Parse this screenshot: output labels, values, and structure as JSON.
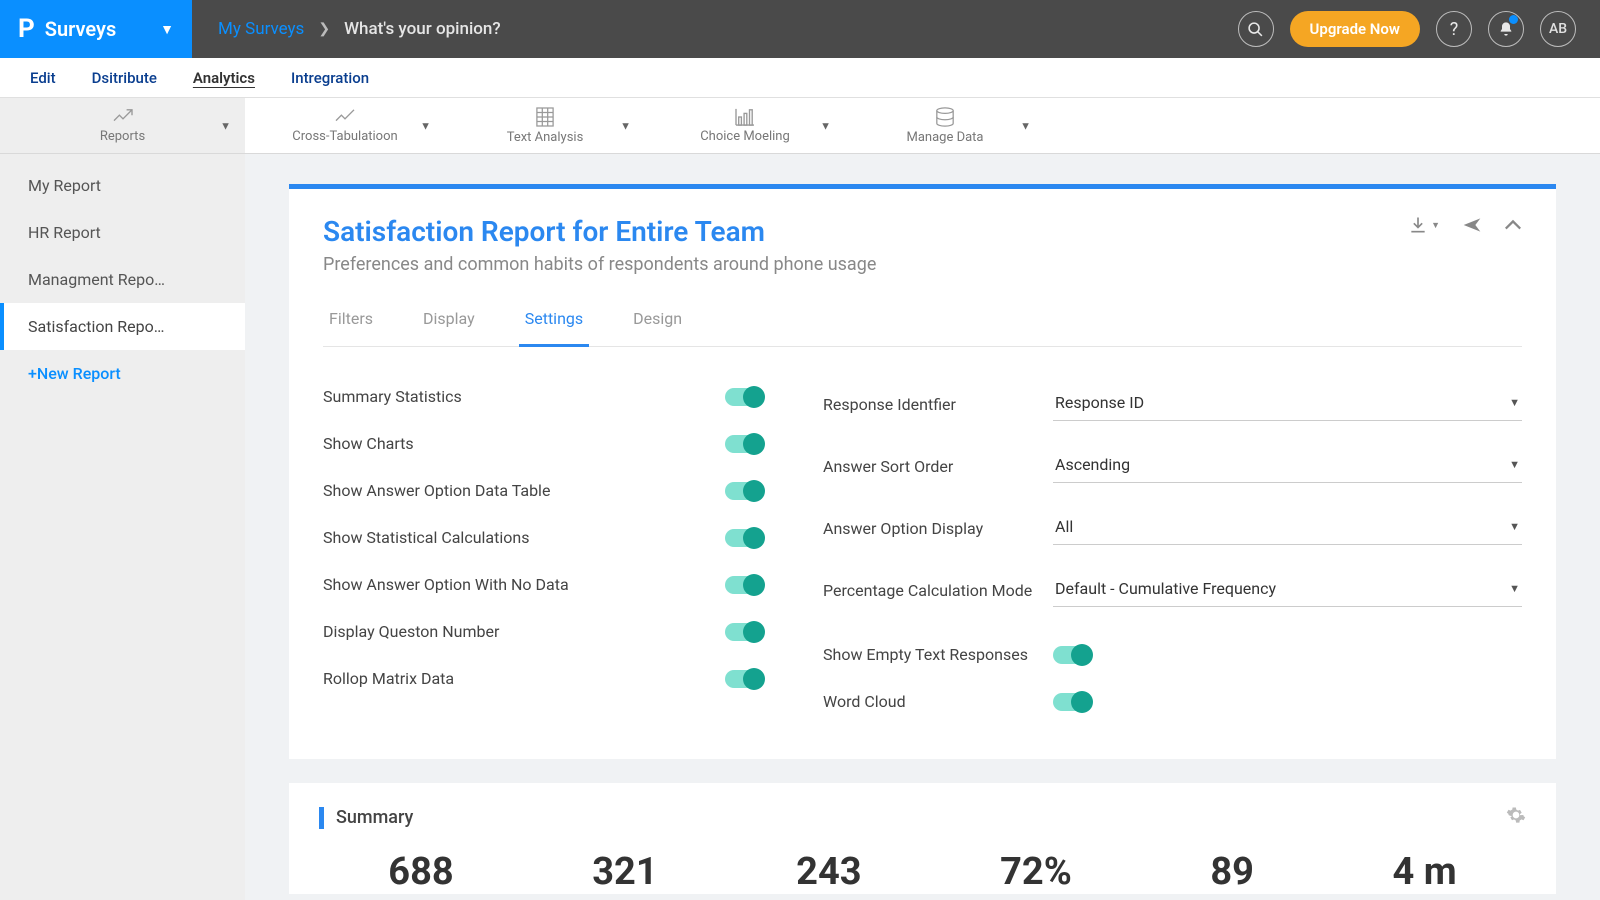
{
  "brand": {
    "name": "Surveys"
  },
  "breadcrumb": {
    "root": "My Surveys",
    "current": "What's your opinion?"
  },
  "header": {
    "upgrade_label": "Upgrade Now",
    "avatar_initials": "AB"
  },
  "nav_tabs": {
    "items": [
      "Edit",
      "Dsitribute",
      "Analytics",
      "Intregration"
    ],
    "active_index": 2
  },
  "ribbon": {
    "items": [
      "Reports",
      "Cross-Tabulatioon",
      "Text Analysis",
      "Choice Moeling",
      "Manage Data"
    ]
  },
  "sidebar": {
    "items": [
      "My Report",
      "HR Report",
      "Managment Repo…",
      "Satisfaction Repo…"
    ],
    "active_index": 3,
    "new_label": "+New Report"
  },
  "report": {
    "title": "Satisfaction Report for Entire Team",
    "subtitle": "Preferences and common habits of respondents around phone usage",
    "tabs": [
      "Filters",
      "Display",
      "Settings",
      "Design"
    ],
    "active_tab_index": 2,
    "toggles_left": [
      {
        "label": "Summary Statistics",
        "on": true
      },
      {
        "label": "Show Charts",
        "on": true
      },
      {
        "label": "Show Answer Option Data Table",
        "on": true
      },
      {
        "label": "Show Statistical Calculations",
        "on": true
      },
      {
        "label": "Show Answer Option With No Data",
        "on": true
      },
      {
        "label": "Display Queston Number",
        "on": true
      },
      {
        "label": "Rollop Matrix Data",
        "on": true
      }
    ],
    "selects_right": [
      {
        "label": "Response Identfier",
        "value": "Response ID"
      },
      {
        "label": "Answer Sort Order",
        "value": "Ascending"
      },
      {
        "label": "Answer Option Display",
        "value": "All"
      },
      {
        "label": "Percentage Calculation Mode",
        "value": "Default - Cumulative Frequency"
      }
    ],
    "toggles_right": [
      {
        "label": "Show Empty Text Responses",
        "on": true
      },
      {
        "label": "Word Cloud",
        "on": true
      }
    ]
  },
  "summary": {
    "title": "Summary",
    "stats": [
      "688",
      "321",
      "243",
      "72%",
      "89",
      "4 m"
    ]
  }
}
